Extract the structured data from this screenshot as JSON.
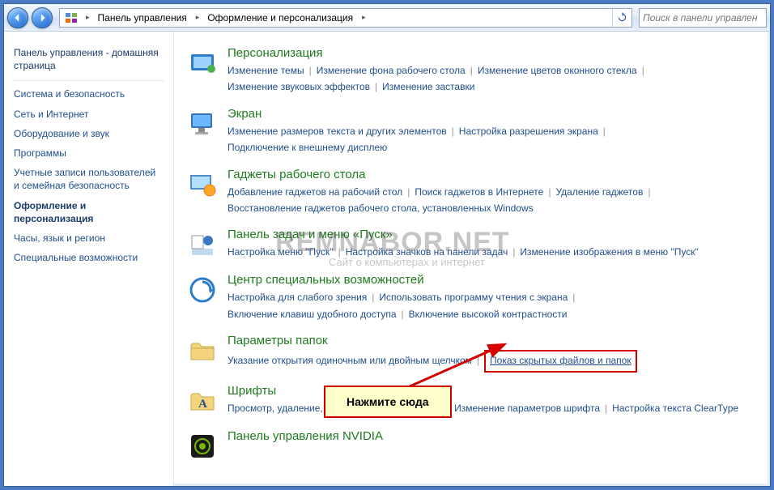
{
  "toolbar": {
    "breadcrumb": [
      "Панель управления",
      "Оформление и персонализация"
    ]
  },
  "search": {
    "placeholder": "Поиск в панели управлен"
  },
  "sidebar": {
    "heading": "Панель управления - домашняя страница",
    "items": [
      "Система и безопасность",
      "Сеть и Интернет",
      "Оборудование и звук",
      "Программы",
      "Учетные записи пользователей и семейная безопасность",
      "Оформление и персонализация",
      "Часы, язык и регион",
      "Специальные возможности"
    ],
    "current_index": 5
  },
  "categories": [
    {
      "title": "Персонализация",
      "links": [
        "Изменение темы",
        "Изменение фона рабочего стола",
        "Изменение цветов оконного стекла",
        "Изменение звуковых эффектов",
        "Изменение заставки"
      ]
    },
    {
      "title": "Экран",
      "links": [
        "Изменение размеров текста и других элементов",
        "Настройка разрешения экрана",
        "Подключение к внешнему дисплею"
      ]
    },
    {
      "title": "Гаджеты рабочего стола",
      "links": [
        "Добавление гаджетов на рабочий стол",
        "Поиск гаджетов в Интернете",
        "Удаление гаджетов",
        "Восстановление гаджетов рабочего стола, установленных Windows"
      ]
    },
    {
      "title": "Панель задач и меню «Пуск»",
      "links": [
        "Настройка меню \"Пуск\"",
        "Настройка значков на панели задач",
        "Изменение изображения в меню \"Пуск\""
      ]
    },
    {
      "title": "Центр специальных возможностей",
      "links": [
        "Настройка для слабого зрения",
        "Использовать программу чтения с экрана",
        "Включение клавиш удобного доступа",
        "Включение высокой контрастности"
      ]
    },
    {
      "title": "Параметры папок",
      "links": [
        "Указание открытия одиночным или двойным щелчком",
        "Показ скрытых файлов и папок"
      ],
      "highlight_index": 1
    },
    {
      "title": "Шрифты",
      "links": [
        "Просмотр, удаление, показ и скрытие шрифтов",
        "Изменение параметров шрифта",
        "Настройка текста ClearType"
      ]
    },
    {
      "title": "Панель управления NVIDIA",
      "links": []
    }
  ],
  "callout": {
    "text": "Нажмите сюда"
  },
  "watermark": {
    "main": "REMNABOR.NET",
    "sub": "Сайт о компьютерах и интернет"
  }
}
